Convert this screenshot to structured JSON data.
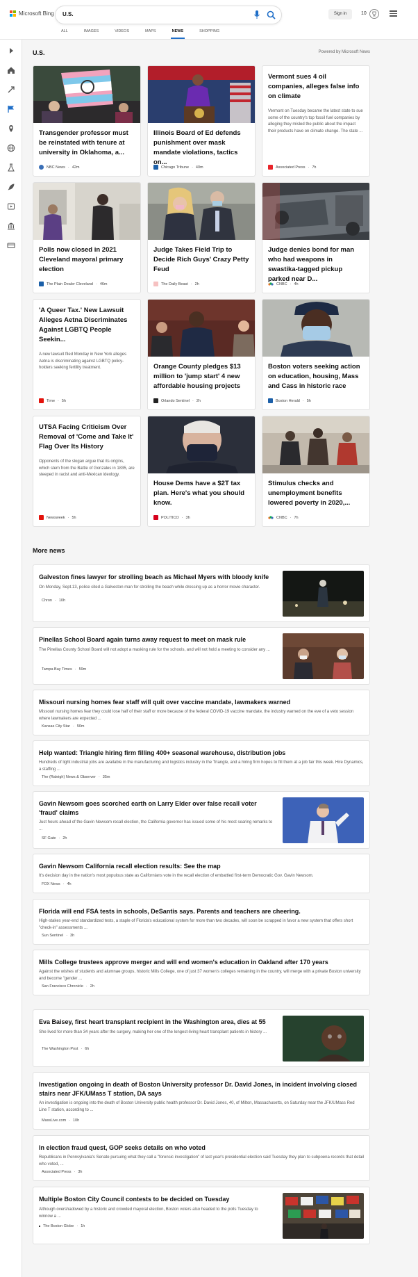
{
  "header": {
    "logo_text": "Microsoft Bing",
    "query": "U.S.",
    "sign_in": "Sign in",
    "points": "10",
    "tabs": [
      "ALL",
      "IMAGES",
      "VIDEOS",
      "MAPS",
      "NEWS",
      "SHOPPING"
    ],
    "active_tab": "NEWS"
  },
  "section": {
    "title": "U.S.",
    "powered_by": "Powered by Microsoft News"
  },
  "cards": [
    {
      "title": "Transgender professor must be reinstated with tenure at university in Oklahoma, a...",
      "source": "NBC News",
      "time": "42m",
      "snippet": ""
    },
    {
      "title": "Illinois Board of Ed defends punishment over mask mandate violations, tactics on...",
      "source": "Chicago Tribune",
      "time": "40m",
      "snippet": ""
    },
    {
      "title": "Vermont sues 4 oil companies, alleges false info on climate",
      "source": "Associated Press",
      "time": "7h",
      "snippet": "Vermont on Tuesday became the latest state to sue some of the country's top fossil fuel companies by alleging they misled the public about the impact their products have on climate change. The state ..."
    },
    {
      "title": "Polls now closed in 2021 Cleveland mayoral primary election",
      "source": "The Plain Dealer Cleveland",
      "time": "46m",
      "snippet": ""
    },
    {
      "title": "Judge Takes Field Trip to Decide Rich Guys' Crazy Petty Feud",
      "source": "The Daily Beast",
      "time": "2h",
      "snippet": ""
    },
    {
      "title": "Judge denies bond for man who had weapons in swastika-tagged pickup parked near D...",
      "source": "CNBC",
      "time": "4h",
      "snippet": ""
    },
    {
      "title": "'A Queer Tax.' New Lawsuit Alleges Aetna Discriminates Against LGBTQ People Seekin...",
      "source": "Time",
      "time": "5h",
      "snippet": "A new lawsuit filed Monday in New York alleges Aetna is discriminating against LGBTQ policy-holders seeking fertility treatment."
    },
    {
      "title": "Orange County pledges $13 million to 'jump start' 4 new affordable housing projects",
      "source": "Orlando Sentinel",
      "time": "2h",
      "snippet": ""
    },
    {
      "title": "Boston voters seeking action on education, housing, Mass and Cass in historic race",
      "source": "Boston Herald",
      "time": "5h",
      "snippet": ""
    },
    {
      "title": "UTSA Facing Criticism Over Removal of 'Come and Take It' Flag Over Its History",
      "source": "Newsweek",
      "time": "5h",
      "snippet": "Opponents of the slogan argue that its origins, which stem from the Battle of Gonzales in 1835, are steeped in racist and anti-Mexican ideology."
    },
    {
      "title": "House Dems have a $2T tax plan. Here's what you should know.",
      "source": "POLITICO",
      "time": "3h",
      "snippet": ""
    },
    {
      "title": "Stimulus checks and unemployment benefits lowered poverty in 2020,...",
      "source": "CNBC",
      "time": "7h",
      "snippet": ""
    }
  ],
  "more_news": {
    "title": "More news",
    "items": [
      {
        "title": "Galveston fines lawyer for strolling beach as Michael Myers with bloody knife",
        "snippet": "On Monday, Sept.13, police cited a Galveston man for strolling the beach while dressing up as a horror movie character.",
        "source": "Chron",
        "time": "10h"
      },
      {
        "title": "Pinellas School Board again turns away request to meet on mask rule",
        "snippet": "The Pinellas County School Board will not adopt a masking rule for the schools, and will not hold a meeting to consider any ...",
        "source": "Tampa Bay Times",
        "time": "59m"
      },
      {
        "title": "Missouri nursing homes fear staff will quit over vaccine mandate, lawmakers warned",
        "snippet": "Missouri nursing homes fear they could lose half of their staff or more because of the federal COVID-19 vaccine mandate, the industry warned on the eve of a veto session where lawmakers are expected ...",
        "source": "Kansas City Star",
        "time": "50m"
      },
      {
        "title": "Help wanted: Triangle hiring firm filling 400+ seasonal warehouse, distribution jobs",
        "snippet": "Hundreds of light industrial jobs are available in the manufacturing and logistics industry in the Triangle, and a hiring firm hopes to fill them at a job fair this week. Hire Dynamics, a staffing ...",
        "source": "The (Raleigh) News & Observer",
        "time": "35m"
      },
      {
        "title": "Gavin Newsom goes scorched earth on Larry Elder over false recall voter 'fraud' claims",
        "snippet": "Just hours ahead of the Gavin Newsom recall election, the California governor has issued some of his most searing remarks to ...",
        "source": "SF Gate",
        "time": "2h"
      },
      {
        "title": "Gavin Newsom California recall election results: See the map",
        "snippet": "It's decision day in the nation's most populous state as Californians vote in the recall election of embattled first-term Democratic Gov. Gavin Newsom.",
        "source": "FOX News",
        "time": "4h"
      },
      {
        "title": "Florida will end FSA tests in schools, DeSantis says. Parents and teachers are cheering.",
        "snippet": "High-stakes year-end standardized tests, a staple of Florida's educational system for more than two decades, will soon be scrapped in favor a new system that offers short \"check-in\" assessments ...",
        "source": "Sun Sentinel",
        "time": "3h"
      },
      {
        "title": "Mills College trustees approve merger and will end women's education in Oakland after 170 years",
        "snippet": "Against the wishes of students and alumnae groups, historic Mills College, one of just 37 women's colleges remaining in the country, will merge with a private Boston university and become \"gender ...",
        "source": "San Francisco Chronicle",
        "time": "2h"
      },
      {
        "title": "Eva Baisey, first heart transplant recipient in the Washington area, dies at 55",
        "snippet": "She lived for more than 34 years after the surgery, making her one of the longest-living heart transplant patients in history ...",
        "source": "The Washington Post",
        "time": "6h"
      },
      {
        "title": "Investigation ongoing in death of Boston University professor Dr. David Jones, in incident involving closed stairs near JFK/UMass T station, DA says",
        "snippet": "An investigation is ongoing into the death of Boston University public health professor Dr. David Jones, 40, of Milton, Massachusetts, on Saturday near the JFK/UMass Red Line T station, according to ...",
        "source": "MassLive.com",
        "time": "10h"
      },
      {
        "title": "In election fraud quest, GOP seeks details on who voted",
        "snippet": "Republicans in Pennsylvania's Senate pursuing what they call a \"forensic investigation\" of last year's presidential election said Tuesday they plan to subpoena records that detail who voted, ...",
        "source": "Associated Press",
        "time": "3h"
      },
      {
        "title": "Multiple Boston City Council contests to be decided on Tuesday",
        "snippet": "Although overshadowed by a historic and crowded mayoral election, Boston voters also headed to the polls Tuesday to winnow a ...",
        "source": "The Boston Globe",
        "time": "1h"
      }
    ]
  },
  "colors": {
    "accent": "#1e6ec8",
    "background": "#f5f5f5"
  }
}
